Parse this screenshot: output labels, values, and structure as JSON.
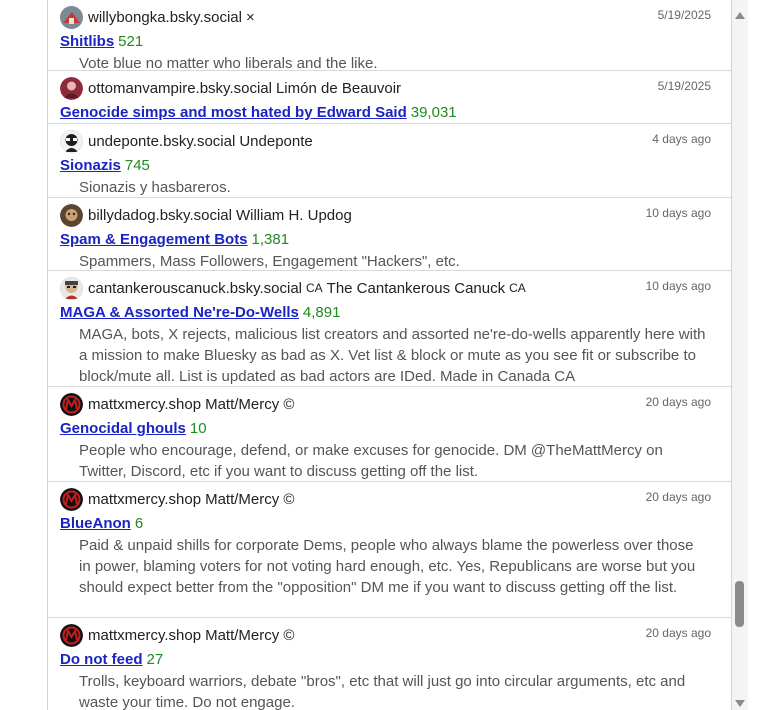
{
  "rows": [
    {
      "handle": "willybongka.bsky.social",
      "display": "×",
      "flag": "",
      "date": "5/19/2025",
      "title": "Shitlibs",
      "count": "521",
      "desc": "Vote blue no matter who liberals and the like.",
      "avatar_color": "#9c8a7a"
    },
    {
      "handle": "ottomanvampire.bsky.social",
      "display": "Limón de Beauvoir",
      "flag": "",
      "date": "5/19/2025",
      "title": "Genocide simps and most hated by Edward Said",
      "count": "39,031",
      "desc": "",
      "avatar_color": "#a23a4a"
    },
    {
      "handle": "undeponte.bsky.social",
      "display": "Undeponte",
      "flag": "",
      "date": "4 days ago",
      "title": "Sionazis",
      "count": "745",
      "desc": "Sionazis y hasbareros.",
      "avatar_color": "#2a2a2a"
    },
    {
      "handle": "billydadog.bsky.social",
      "display": "William H. Updog",
      "flag": "",
      "date": "10 days ago",
      "title": "Spam & Engagement Bots",
      "count": "1,381",
      "desc": "Spammers, Mass Followers, Engagement \"Hackers\", etc.",
      "avatar_color": "#7a5a3a"
    },
    {
      "handle": "cantankerouscanuck.bsky.social",
      "display": "The Cantankerous Canuck",
      "flag": "CA",
      "pre_flag": "CA",
      "date": "10 days ago",
      "title": "MAGA & Assorted Ne're-Do-Wells",
      "count": "4,891",
      "desc": "MAGA, bots, X rejects, malicious list creators and assorted ne're-do-wells apparently here with a mission to make Bluesky as bad as X. Vet list & block or mute as you see fit or subscribe to block/mute all. List is updated as bad actors are IDed. Made in Canada CA",
      "avatar_color": "#c9c9c9"
    },
    {
      "handle": "mattxmercy.shop",
      "display": "Matt/Mercy ©",
      "flag": "",
      "date": "20 days ago",
      "title": "Genocidal ghouls",
      "count": "10",
      "desc": "People who encourage, defend, or make excuses for genocide. DM @TheMattMercy on Twitter, Discord, etc if you want to discuss getting off the list.",
      "avatar_color": "#1a1a1a"
    },
    {
      "handle": "mattxmercy.shop",
      "display": "Matt/Mercy ©",
      "flag": "",
      "date": "20 days ago",
      "title": "BlueAnon",
      "count": "6",
      "desc": "Paid & unpaid shills for corporate Dems, people who always blame the powerless over those in power, blaming voters for not voting hard enough, etc. Yes, Republicans are worse but you should expect better from the \"opposition\" DM me if you want to discuss getting off the list.",
      "avatar_color": "#1a1a1a"
    },
    {
      "handle": "mattxmercy.shop",
      "display": "Matt/Mercy ©",
      "flag": "",
      "date": "20 days ago",
      "title": "Do not feed",
      "count": "27",
      "desc": "Trolls, keyboard warriors, debate \"bros\", etc that will just go into circular arguments, etc and waste your time. Do not engage.",
      "avatar_color": "#1a1a1a"
    }
  ]
}
